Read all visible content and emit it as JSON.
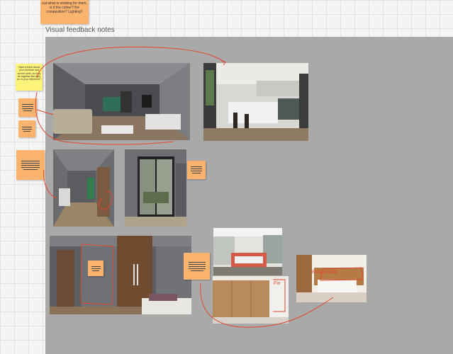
{
  "board": {
    "frame_title": "Visual feedback notes"
  },
  "top_sticky": {
    "text": "out what is working for them, is it the colour? the composition? Lighting?"
  },
  "left_yellow_sticky": {
    "text": "Have a think about your furniture and corner units, do they tie together like they do in your reference?"
  },
  "annotation_labels": {
    "bedroom_scribble": "Fix",
    "small_bedroom_scribble": "Bedside table"
  },
  "colors": {
    "frame_background": "#a9a9a9",
    "sticky_orange": "#fbb36e",
    "sticky_yellow": "#fdf27a",
    "annotation_red": "#e0482f"
  }
}
